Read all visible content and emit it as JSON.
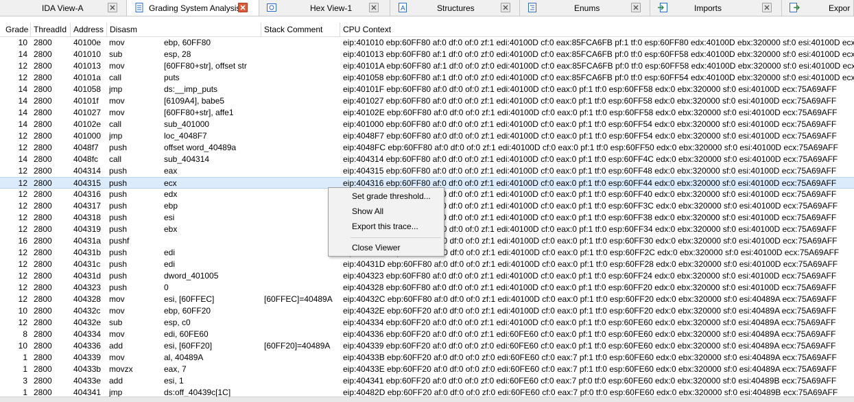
{
  "tabs": [
    {
      "label": "IDA View-A",
      "icon": "ida-view-icon",
      "active": false
    },
    {
      "label": "Grading System Analysis",
      "icon": "document-icon",
      "active": true
    },
    {
      "label": "Hex View-1",
      "icon": "hex-view-icon",
      "active": false
    },
    {
      "label": "Structures",
      "icon": "structures-icon",
      "active": false
    },
    {
      "label": "Enums",
      "icon": "enums-icon",
      "active": false
    },
    {
      "label": "Imports",
      "icon": "imports-icon",
      "active": false
    },
    {
      "label": "Expor",
      "icon": "exports-icon",
      "active": false
    }
  ],
  "columns": [
    "Grade",
    "ThreadId",
    "Address",
    "Disasm",
    "Stack Comment",
    "CPU Context"
  ],
  "rows": [
    {
      "grade": "10",
      "thread": "2800",
      "addr": "40100e",
      "op": "mov",
      "operand": "ebp, 60FF80",
      "stack": "",
      "cpu": "eip:401010 ebp:60FF80 af:0 df:0 of:0 zf:1 edi:40100D cf:0 eax:85FCA6FB pf:1 tf:0 esp:60FF80 edx:40100D ebx:320000 sf:0 esi:40100D ecx:40100D"
    },
    {
      "grade": "14",
      "thread": "2800",
      "addr": "401010",
      "op": "sub",
      "operand": "esp, 28",
      "stack": "",
      "cpu": "eip:401013 ebp:60FF80 af:1 df:0 of:0 zf:0 edi:40100D cf:0 eax:85FCA6FB pf:0 tf:0 esp:60FF58 edx:40100D ebx:320000 sf:0 esi:40100D ecx:40100D"
    },
    {
      "grade": "12",
      "thread": "2800",
      "addr": "401013",
      "op": "mov",
      "operand": "[60FF80+str], offset str",
      "stack": "",
      "cpu": "eip:40101A ebp:60FF80 af:1 df:0 of:0 zf:0 edi:40100D cf:0 eax:85FCA6FB pf:0 tf:0 esp:60FF58 edx:40100D ebx:320000 sf:0 esi:40100D ecx:40100D"
    },
    {
      "grade": "12",
      "thread": "2800",
      "addr": "40101a",
      "op": "call",
      "operand": "puts",
      "stack": "",
      "cpu": "eip:401058 ebp:60FF80 af:1 df:0 of:0 zf:0 edi:40100D cf:0 eax:85FCA6FB pf:0 tf:0 esp:60FF54 edx:40100D ebx:320000 sf:0 esi:40100D ecx:40100D"
    },
    {
      "grade": "14",
      "thread": "2800",
      "addr": "401058",
      "op": "jmp",
      "operand": "ds:__imp_puts",
      "stack": "",
      "cpu": "eip:40101F ebp:60FF80 af:0 df:0 of:0 zf:1 edi:40100D cf:0 eax:0 pf:1 tf:0 esp:60FF58 edx:0 ebx:320000 sf:0 esi:40100D ecx:75A69AFF"
    },
    {
      "grade": "14",
      "thread": "2800",
      "addr": "40101f",
      "op": "mov",
      "operand": "[6109A4], babe5",
      "stack": "",
      "cpu": "eip:401027 ebp:60FF80 af:0 df:0 of:0 zf:1 edi:40100D cf:0 eax:0 pf:1 tf:0 esp:60FF58 edx:0 ebx:320000 sf:0 esi:40100D ecx:75A69AFF"
    },
    {
      "grade": "14",
      "thread": "2800",
      "addr": "401027",
      "op": "mov",
      "operand": "[60FF80+str], affe1",
      "stack": "",
      "cpu": "eip:40102E ebp:60FF80 af:0 df:0 of:0 zf:1 edi:40100D cf:0 eax:0 pf:1 tf:0 esp:60FF58 edx:0 ebx:320000 sf:0 esi:40100D ecx:75A69AFF"
    },
    {
      "grade": "14",
      "thread": "2800",
      "addr": "40102e",
      "op": "call",
      "operand": "sub_401000",
      "stack": "",
      "cpu": "eip:401000 ebp:60FF80 af:0 df:0 of:0 zf:1 edi:40100D cf:0 eax:0 pf:1 tf:0 esp:60FF54 edx:0 ebx:320000 sf:0 esi:40100D ecx:75A69AFF"
    },
    {
      "grade": "12",
      "thread": "2800",
      "addr": "401000",
      "op": "jmp",
      "operand": "loc_4048F7",
      "stack": "",
      "cpu": "eip:4048F7 ebp:60FF80 af:0 df:0 of:0 zf:1 edi:40100D cf:0 eax:0 pf:1 tf:0 esp:60FF54 edx:0 ebx:320000 sf:0 esi:40100D ecx:75A69AFF"
    },
    {
      "grade": "12",
      "thread": "2800",
      "addr": "4048f7",
      "op": "push",
      "operand": "offset word_40489a",
      "stack": "",
      "cpu": "eip:4048FC ebp:60FF80 af:0 df:0 of:0 zf:1 edi:40100D cf:0 eax:0 pf:1 tf:0 esp:60FF50 edx:0 ebx:320000 sf:0 esi:40100D ecx:75A69AFF"
    },
    {
      "grade": "14",
      "thread": "2800",
      "addr": "4048fc",
      "op": "call",
      "operand": "sub_404314",
      "stack": "",
      "cpu": "eip:404314 ebp:60FF80 af:0 df:0 of:0 zf:1 edi:40100D cf:0 eax:0 pf:1 tf:0 esp:60FF4C edx:0 ebx:320000 sf:0 esi:40100D ecx:75A69AFF"
    },
    {
      "grade": "12",
      "thread": "2800",
      "addr": "404314",
      "op": "push",
      "operand": "eax",
      "stack": "",
      "cpu": "eip:404315 ebp:60FF80 af:0 df:0 of:0 zf:1 edi:40100D cf:0 eax:0 pf:1 tf:0 esp:60FF48 edx:0 ebx:320000 sf:0 esi:40100D ecx:75A69AFF"
    },
    {
      "grade": "12",
      "thread": "2800",
      "addr": "404315",
      "op": "push",
      "operand": "ecx",
      "stack": "",
      "cpu": "eip:404316 ebp:60FF80 af:0 df:0 of:0 zf:1 edi:40100D cf:0 eax:0 pf:1 tf:0 esp:60FF44 edx:0 ebx:320000 sf:0 esi:40100D ecx:75A69AFF",
      "selected": true
    },
    {
      "grade": "12",
      "thread": "2800",
      "addr": "404316",
      "op": "push",
      "operand": "edx",
      "stack": "",
      "cpu": "eip:404317 ebp:60FF80 af:0 df:0 of:0 zf:1 edi:40100D cf:0 eax:0 pf:1 tf:0 esp:60FF40 edx:0 ebx:320000 sf:0 esi:40100D ecx:75A69AFF"
    },
    {
      "grade": "12",
      "thread": "2800",
      "addr": "404317",
      "op": "push",
      "operand": "ebp",
      "stack": "",
      "cpu": "eip:404318 ebp:60FF80 af:0 df:0 of:0 zf:1 edi:40100D cf:0 eax:0 pf:1 tf:0 esp:60FF3C edx:0 ebx:320000 sf:0 esi:40100D ecx:75A69AFF"
    },
    {
      "grade": "12",
      "thread": "2800",
      "addr": "404318",
      "op": "push",
      "operand": "esi",
      "stack": "",
      "cpu": "eip:404319 ebp:60FF80 af:0 df:0 of:0 zf:1 edi:40100D cf:0 eax:0 pf:1 tf:0 esp:60FF38 edx:0 ebx:320000 sf:0 esi:40100D ecx:75A69AFF"
    },
    {
      "grade": "12",
      "thread": "2800",
      "addr": "404319",
      "op": "push",
      "operand": "ebx",
      "stack": "",
      "cpu": "eip:40431A ebp:60FF80 af:0 df:0 of:0 zf:1 edi:40100D cf:0 eax:0 pf:1 tf:0 esp:60FF34 edx:0 ebx:320000 sf:0 esi:40100D ecx:75A69AFF"
    },
    {
      "grade": "16",
      "thread": "2800",
      "addr": "40431a",
      "op": "pushf",
      "operand": "",
      "stack": "",
      "cpu": "eip:40431B ebp:60FF80 af:0 df:0 of:0 zf:1 edi:40100D cf:0 eax:0 pf:1 tf:0 esp:60FF30 edx:0 ebx:320000 sf:0 esi:40100D ecx:75A69AFF"
    },
    {
      "grade": "12",
      "thread": "2800",
      "addr": "40431b",
      "op": "push",
      "operand": "edi",
      "stack": "",
      "cpu": "eip:40431C ebp:60FF80 af:0 df:0 of:0 zf:1 edi:40100D cf:0 eax:0 pf:1 tf:0 esp:60FF2C edx:0 ebx:320000 sf:0 esi:40100D ecx:75A69AFF"
    },
    {
      "grade": "12",
      "thread": "2800",
      "addr": "40431c",
      "op": "push",
      "operand": "edi",
      "stack": "",
      "cpu": "eip:40431D ebp:60FF80 af:0 df:0 of:0 zf:1 edi:40100D cf:0 eax:0 pf:1 tf:0 esp:60FF28 edx:0 ebx:320000 sf:0 esi:40100D ecx:75A69AFF"
    },
    {
      "grade": "12",
      "thread": "2800",
      "addr": "40431d",
      "op": "push",
      "operand": "dword_401005",
      "stack": "",
      "cpu": "eip:404323 ebp:60FF80 af:0 df:0 of:0 zf:1 edi:40100D cf:0 eax:0 pf:1 tf:0 esp:60FF24 edx:0 ebx:320000 sf:0 esi:40100D ecx:75A69AFF"
    },
    {
      "grade": "12",
      "thread": "2800",
      "addr": "404323",
      "op": "push",
      "operand": "0",
      "stack": "",
      "cpu": "eip:404328 ebp:60FF80 af:0 df:0 of:0 zf:1 edi:40100D cf:0 eax:0 pf:1 tf:0 esp:60FF20 edx:0 ebx:320000 sf:0 esi:40100D ecx:75A69AFF"
    },
    {
      "grade": "12",
      "thread": "2800",
      "addr": "404328",
      "op": "mov",
      "operand": "esi, [60FFEC]",
      "stack": "[60FFEC]=40489A",
      "cpu": "eip:40432C ebp:60FF80 af:0 df:0 of:0 zf:1 edi:40100D cf:0 eax:0 pf:1 tf:0 esp:60FF20 edx:0 ebx:320000 sf:0 esi:40489A ecx:75A69AFF"
    },
    {
      "grade": "10",
      "thread": "2800",
      "addr": "40432c",
      "op": "mov",
      "operand": "ebp, 60FF20",
      "stack": "",
      "cpu": "eip:40432E ebp:60FF20 af:0 df:0 of:0 zf:1 edi:40100D cf:0 eax:0 pf:1 tf:0 esp:60FF20 edx:0 ebx:320000 sf:0 esi:40489A ecx:75A69AFF"
    },
    {
      "grade": "12",
      "thread": "2800",
      "addr": "40432e",
      "op": "sub",
      "operand": "esp, c0",
      "stack": "",
      "cpu": "eip:404334 ebp:60FF20 af:0 df:0 of:0 zf:1 edi:40100D cf:0 eax:0 pf:1 tf:0 esp:60FE60 edx:0 ebx:320000 sf:0 esi:40489A ecx:75A69AFF"
    },
    {
      "grade": "8",
      "thread": "2800",
      "addr": "404334",
      "op": "mov",
      "operand": "edi, 60FE60",
      "stack": "",
      "cpu": "eip:404336 ebp:60FF20 af:0 df:0 of:0 zf:1 edi:60FE60 cf:0 eax:0 pf:1 tf:0 esp:60FE60 edx:0 ebx:320000 sf:0 esi:40489A ecx:75A69AFF"
    },
    {
      "grade": "10",
      "thread": "2800",
      "addr": "404336",
      "op": "add",
      "operand": "esi, [60FF20]",
      "stack": "[60FF20]=40489A",
      "cpu": "eip:404339 ebp:60FF20 af:0 df:0 of:0 zf:0 edi:60FE60 cf:0 eax:0 pf:1 tf:0 esp:60FE60 edx:0 ebx:320000 sf:0 esi:40489A ecx:75A69AFF"
    },
    {
      "grade": "1",
      "thread": "2800",
      "addr": "404339",
      "op": "mov",
      "operand": "al, 40489A",
      "stack": "",
      "cpu": "eip:40433B ebp:60FF20 af:0 df:0 of:0 zf:0 edi:60FE60 cf:0 eax:7 pf:1 tf:0 esp:60FE60 edx:0 ebx:320000 sf:0 esi:40489A ecx:75A69AFF"
    },
    {
      "grade": "1",
      "thread": "2800",
      "addr": "40433b",
      "op": "movzx",
      "operand": "eax, 7",
      "stack": "",
      "cpu": "eip:40433E ebp:60FF20 af:0 df:0 of:0 zf:0 edi:60FE60 cf:0 eax:7 pf:1 tf:0 esp:60FE60 edx:0 ebx:320000 sf:0 esi:40489A ecx:75A69AFF"
    },
    {
      "grade": "3",
      "thread": "2800",
      "addr": "40433e",
      "op": "add",
      "operand": "esi, 1",
      "stack": "",
      "cpu": "eip:404341 ebp:60FF20 af:0 df:0 of:0 zf:0 edi:60FE60 cf:0 eax:7 pf:0 tf:0 esp:60FE60 edx:0 ebx:320000 sf:0 esi:40489B ecx:75A69AFF"
    },
    {
      "grade": "1",
      "thread": "2800",
      "addr": "404341",
      "op": "jmp",
      "operand": "ds:off_40439c[1C]",
      "stack": "",
      "cpu": "eip:40482D ebp:60FF20 af:0 df:0 of:0 zf:0 edi:60FE60 cf:0 eax:7 pf:0 tf:0 esp:60FE60 edx:0 ebx:320000 sf:0 esi:40489B ecx:75A69AFF"
    }
  ],
  "context_menu": {
    "items": [
      "Set grade threshold...",
      "Show All",
      "Export this trace...",
      "Close Viewer"
    ]
  },
  "colors": {
    "selected_row": "#dcebfb",
    "active_tab_close": "#e05a3a"
  }
}
